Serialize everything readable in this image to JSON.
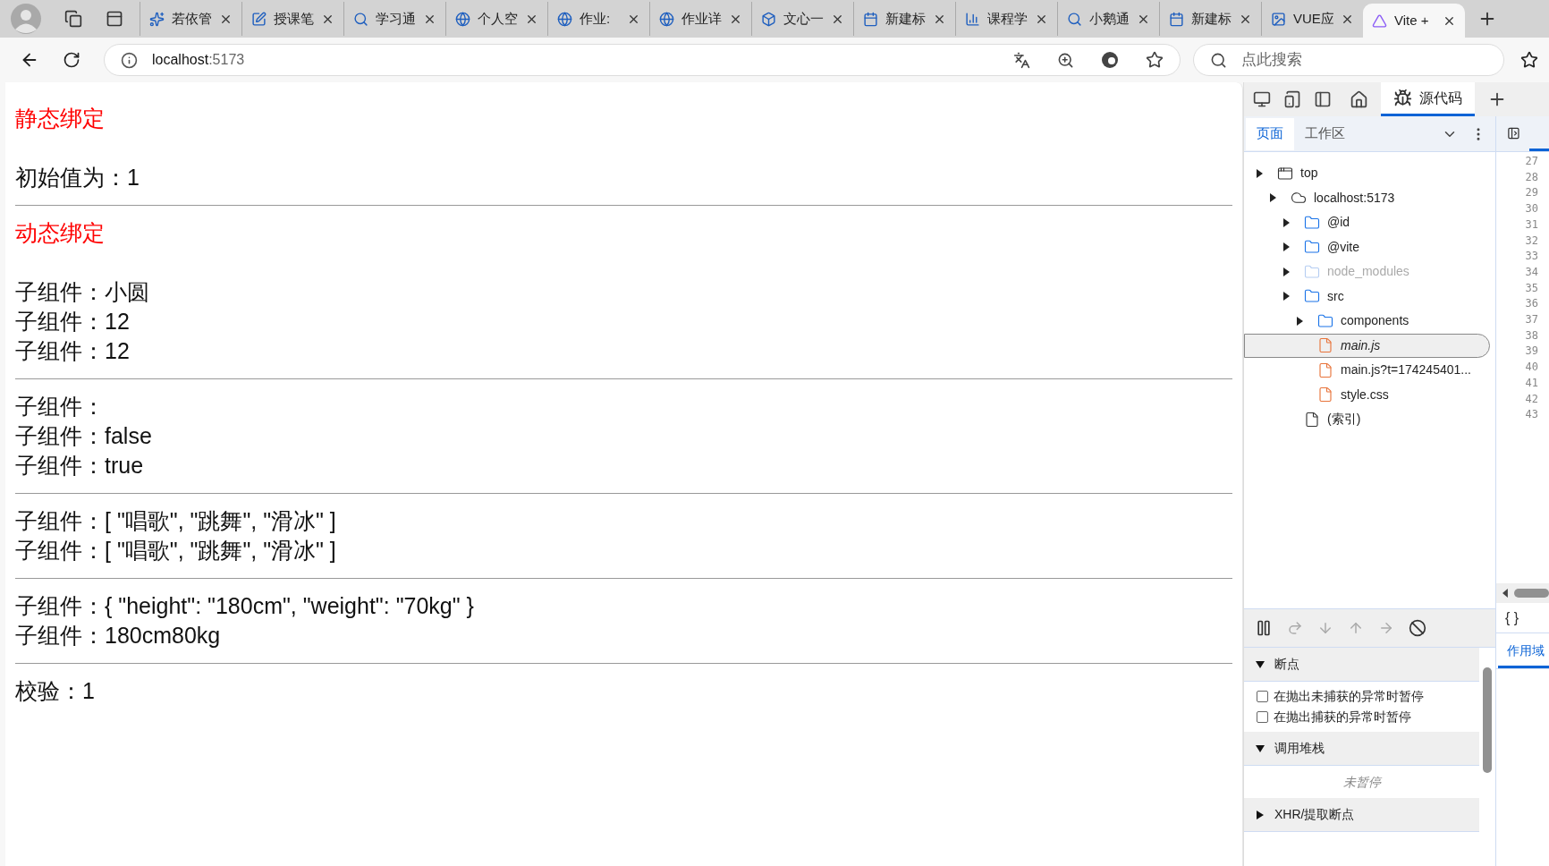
{
  "browser": {
    "tabs": [
      {
        "title": "若依管",
        "selected": false
      },
      {
        "title": "授课笔",
        "selected": false
      },
      {
        "title": "学习通",
        "selected": false
      },
      {
        "title": "个人空",
        "selected": false
      },
      {
        "title": "作业:",
        "selected": false
      },
      {
        "title": "作业详",
        "selected": false
      },
      {
        "title": "文心一",
        "selected": false
      },
      {
        "title": "新建标",
        "selected": false
      },
      {
        "title": "课程学",
        "selected": false
      },
      {
        "title": "小鹅通",
        "selected": false
      },
      {
        "title": "新建标",
        "selected": false
      },
      {
        "title": "VUE应",
        "selected": false
      },
      {
        "title": "Vite +",
        "selected": true
      }
    ],
    "address": {
      "host": "localhost",
      "port": ":5173"
    },
    "search": {
      "placeholder": "点此搜索"
    }
  },
  "page": {
    "sections": [
      {
        "heading": "静态绑定",
        "lines": [
          "初始值为：1"
        ]
      },
      {
        "heading": "动态绑定",
        "lines": [
          "子组件：小圆",
          "子组件：12",
          "子组件：12"
        ]
      },
      {
        "lines": [
          "子组件：",
          "子组件：false",
          "子组件：true"
        ]
      },
      {
        "lines": [
          "子组件：[ \"唱歌\", \"跳舞\", \"滑冰\" ]",
          "子组件：[ \"唱歌\", \"跳舞\", \"滑冰\" ]"
        ]
      },
      {
        "lines": [
          "子组件：{ \"height\": \"180cm\", \"weight\": \"70kg\" }",
          "子组件：180cm80kg"
        ]
      },
      {
        "lines": [
          "校验：1"
        ]
      }
    ]
  },
  "devtools": {
    "panel_tab": "源代码",
    "nav_tabs": [
      {
        "label": "页面",
        "selected": true
      },
      {
        "label": "工作区",
        "selected": false
      }
    ],
    "tree": [
      {
        "kind": "frame",
        "name": "top",
        "dimmed": false,
        "selected": false,
        "children": [
          {
            "kind": "origin",
            "name": "localhost:5173",
            "dimmed": false,
            "selected": false,
            "children": [
              {
                "kind": "folder",
                "name": "@id",
                "dimmed": false,
                "selected": false
              },
              {
                "kind": "folder",
                "name": "@vite",
                "dimmed": false,
                "selected": false
              },
              {
                "kind": "folder",
                "name": "node_modules",
                "dimmed": true,
                "selected": false
              },
              {
                "kind": "folder",
                "name": "src",
                "dimmed": false,
                "selected": false,
                "children": [
                  {
                    "kind": "folder",
                    "name": "components",
                    "dimmed": false,
                    "selected": false
                  },
                  {
                    "kind": "file",
                    "name": "main.js",
                    "dimmed": false,
                    "selected": true
                  },
                  {
                    "kind": "file",
                    "name": "main.js?t=174245401...",
                    "dimmed": false,
                    "selected": false
                  },
                  {
                    "kind": "file",
                    "name": "style.css",
                    "dimmed": false,
                    "selected": false
                  }
                ]
              },
              {
                "kind": "index",
                "name": "(索引)",
                "dimmed": false,
                "selected": false
              }
            ]
          }
        ]
      }
    ],
    "line_numbers": [
      "27",
      "28",
      "29",
      "30",
      "31",
      "32",
      "33",
      "34",
      "35",
      "36",
      "37",
      "38",
      "39",
      "40",
      "41",
      "42",
      "43"
    ],
    "format_button": "{ }",
    "sections": [
      {
        "title": "断点",
        "expanded": true,
        "options": [
          {
            "label": "在抛出未捕获的异常时暂停",
            "checked": false
          },
          {
            "label": "在抛出捕获的异常时暂停",
            "checked": false
          }
        ]
      },
      {
        "title": "调用堆栈",
        "expanded": true,
        "note": "未暂停"
      },
      {
        "title": "XHR/提取断点",
        "expanded": false
      }
    ],
    "side_tab": {
      "label": "作用域",
      "selected": true
    }
  }
}
